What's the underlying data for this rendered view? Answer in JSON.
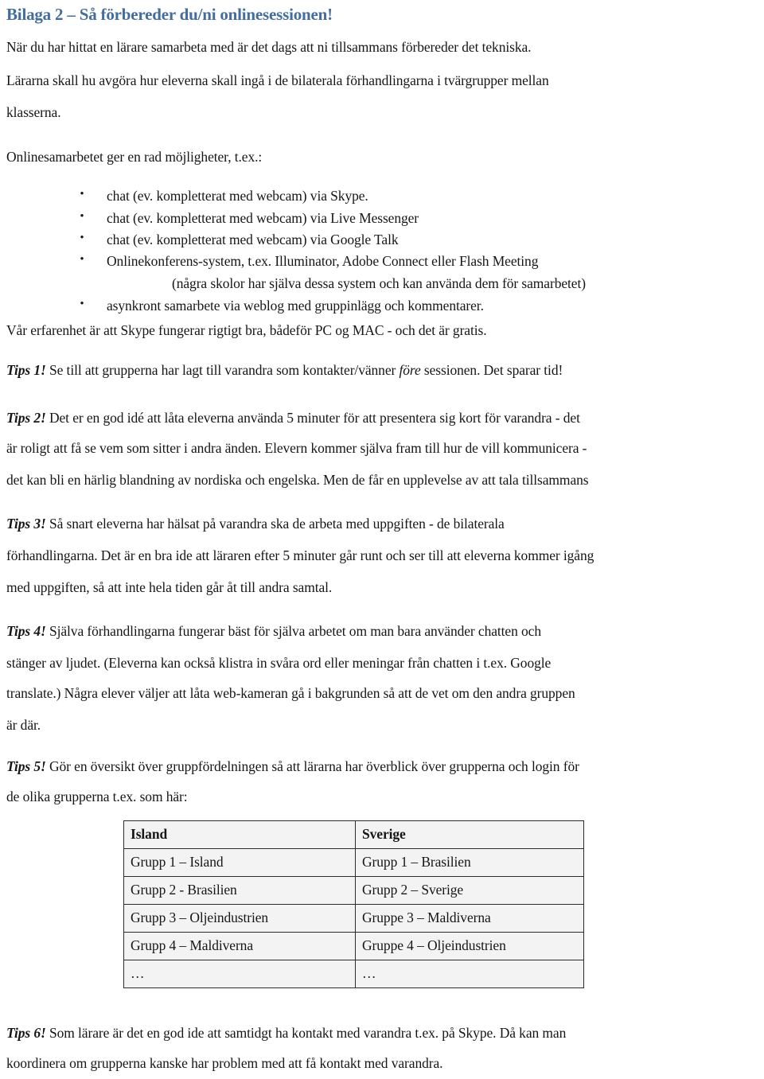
{
  "document": {
    "title": "Bilaga 2 – Så förbereder du/ni onlinesessionen!"
  },
  "intro": {
    "line1": "När du har hittat en lärare samarbeta med är det dags att ni tillsammans förbereder det tekniska.",
    "line2": "Lärarna skall hu avgöra hur eleverna skall ingå i de bilaterala förhandlingarna i tvärgrupper mellan",
    "line3": "klasserna.",
    "line4": "Onlinesamarbetet ger en rad möjligheter, t.ex.:"
  },
  "bullets": {
    "marker": "•",
    "items": [
      "chat (ev. kompletterat med webcam) via Skype.",
      "chat (ev. kompletterat med webcam)  via Live Messenger",
      "chat (ev. kompletterat med webcam)  via Google Talk",
      "Onlinekonferens-system, t.ex. Illuminator, Adobe Connect eller Flash Meeting",
      "asynkront samarbete via weblog med gruppinlägg och kommentarer."
    ],
    "continuation": "(några skolor har själva dessa system och kan använda dem för samarbetet)"
  },
  "experience": {
    "line": "Vår erfarenhet är att  Skype fungerar rigtigt bra, bådeför PC og MAC -  och det är gratis."
  },
  "tips": {
    "tip1": {
      "label": "Tips 1!",
      "line1_a": " Se till att grupperna har lagt till varandra som kontakter/vänner ",
      "line1_em": "före",
      "line1_b": " sessionen. Det sparar tid!"
    },
    "tip2": {
      "label": "Tips 2!",
      "line1": " Det er en god idé att låta eleverna använda 5 minuter för att presentera sig kort för varandra -  det",
      "line2": "är roligt att få se vem som sitter i andra änden. Elevern kommer själva fram till hur de vill kommunicera -",
      "line3": "det kan bli en härlig blandning av nordiska och engelska. Men de får en upplevelse av att tala tillsammans"
    },
    "tip3": {
      "label": "Tips 3!",
      "line1": " Så snart eleverna har hälsat på varandra ska de arbeta med uppgiften - de bilaterala",
      "line2": "förhandlingarna. Det är en bra ide att läraren efter 5 minuter går runt och ser till att eleverna kommer igång",
      "line3": "med uppgiften, så att inte hela tiden går åt till andra samtal."
    },
    "tip4": {
      "label": "Tips 4!",
      "line1": " Själva förhandlingarna fungerar bäst för själva arbetet om man bara använder chatten och",
      "line2": "stänger av ljudet. (Eleverna kan också klistra in svåra ord eller meningar från chatten i t.ex. Google",
      "line3": "translate.) Några elever väljer att låta web-kameran gå i bakgrunden så att de vet om den andra gruppen",
      "line4": "är där."
    },
    "tip5": {
      "label": "Tips 5!",
      "line1": " Gör en översikt över gruppfördelningen så att lärarna har överblick över grupperna och login för",
      "line2": "de olika grupperna t.ex. som här:"
    },
    "tip6": {
      "label": "Tips 6!",
      "line1": " Som lärare är det en god ide att samtidgt ha kontakt med varandra t.ex. på Skype. Då kan man",
      "line2": "koordinera om grupperna kanske har problem med att få kontakt med varandra."
    }
  },
  "group_table": {
    "headers": [
      "Island",
      "Sverige"
    ],
    "rows": [
      [
        "Grupp 1 – Island",
        "Grupp 1 – Brasilien"
      ],
      [
        "Grupp 2 - Brasilien",
        "Grupp 2 – Sverige"
      ],
      [
        "Grupp 3 – Oljeindustrien",
        "Gruppe 3 – Maldiverna"
      ],
      [
        "Grupp 4 – Maldiverna",
        "Gruppe 4 – Oljeindustrien"
      ],
      [
        "…",
        "…"
      ]
    ]
  },
  "colors": {
    "title": "#436d9c",
    "body_text": "#161616",
    "table_fill": "#f3f3f3",
    "table_border": "#2b2b2b"
  }
}
